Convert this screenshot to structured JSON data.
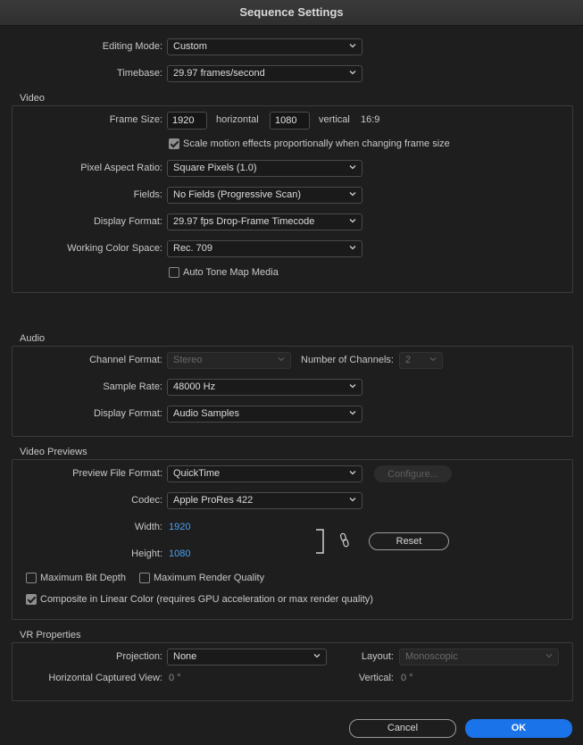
{
  "window": {
    "title": "Sequence Settings"
  },
  "general": {
    "editing_mode_label": "Editing Mode:",
    "editing_mode_value": "Custom",
    "timebase_label": "Timebase:",
    "timebase_value": "29.97  frames/second"
  },
  "video": {
    "group_title": "Video",
    "frame_size_label": "Frame Size:",
    "frame_width": "1920",
    "horizontal_label": "horizontal",
    "frame_height": "1080",
    "vertical_label": "vertical",
    "aspect_text": "16:9",
    "scale_motion_label": "Scale motion effects proportionally when changing frame size",
    "scale_motion_checked": true,
    "pixel_aspect_label": "Pixel Aspect Ratio:",
    "pixel_aspect_value": "Square Pixels (1.0)",
    "fields_label": "Fields:",
    "fields_value": "No Fields (Progressive Scan)",
    "display_format_label": "Display Format:",
    "display_format_value": "29.97 fps Drop-Frame Timecode",
    "color_space_label": "Working Color Space:",
    "color_space_value": "Rec. 709",
    "auto_tone_label": "Auto Tone Map Media",
    "auto_tone_checked": false
  },
  "audio": {
    "group_title": "Audio",
    "channel_format_label": "Channel Format:",
    "channel_format_value": "Stereo",
    "num_channels_label": "Number of Channels:",
    "num_channels_value": "2",
    "sample_rate_label": "Sample Rate:",
    "sample_rate_value": "48000 Hz",
    "display_format_label": "Display Format:",
    "display_format_value": "Audio Samples"
  },
  "previews": {
    "group_title": "Video Previews",
    "file_format_label": "Preview File Format:",
    "file_format_value": "QuickTime",
    "configure_label": "Configure...",
    "codec_label": "Codec:",
    "codec_value": "Apple ProRes 422",
    "width_label": "Width:",
    "width_value": "1920",
    "height_label": "Height:",
    "height_value": "1080",
    "reset_label": "Reset",
    "max_bit_depth_label": "Maximum Bit Depth",
    "max_bit_depth_checked": false,
    "max_render_quality_label": "Maximum Render Quality",
    "max_render_quality_checked": false,
    "linear_color_label": "Composite in Linear Color (requires GPU acceleration or max render quality)",
    "linear_color_checked": true
  },
  "vr": {
    "group_title": "VR Properties",
    "projection_label": "Projection:",
    "projection_value": "None",
    "layout_label": "Layout:",
    "layout_value": "Monoscopic",
    "h_view_label": "Horizontal Captured View:",
    "h_view_value": "0 °",
    "vertical_label": "Vertical:",
    "vertical_value": "0 °"
  },
  "footer": {
    "cancel_label": "Cancel",
    "ok_label": "OK"
  },
  "colors": {
    "background": "#1e1e1e",
    "accent": "#1a73e8",
    "link_value": "#4aa0f0"
  }
}
